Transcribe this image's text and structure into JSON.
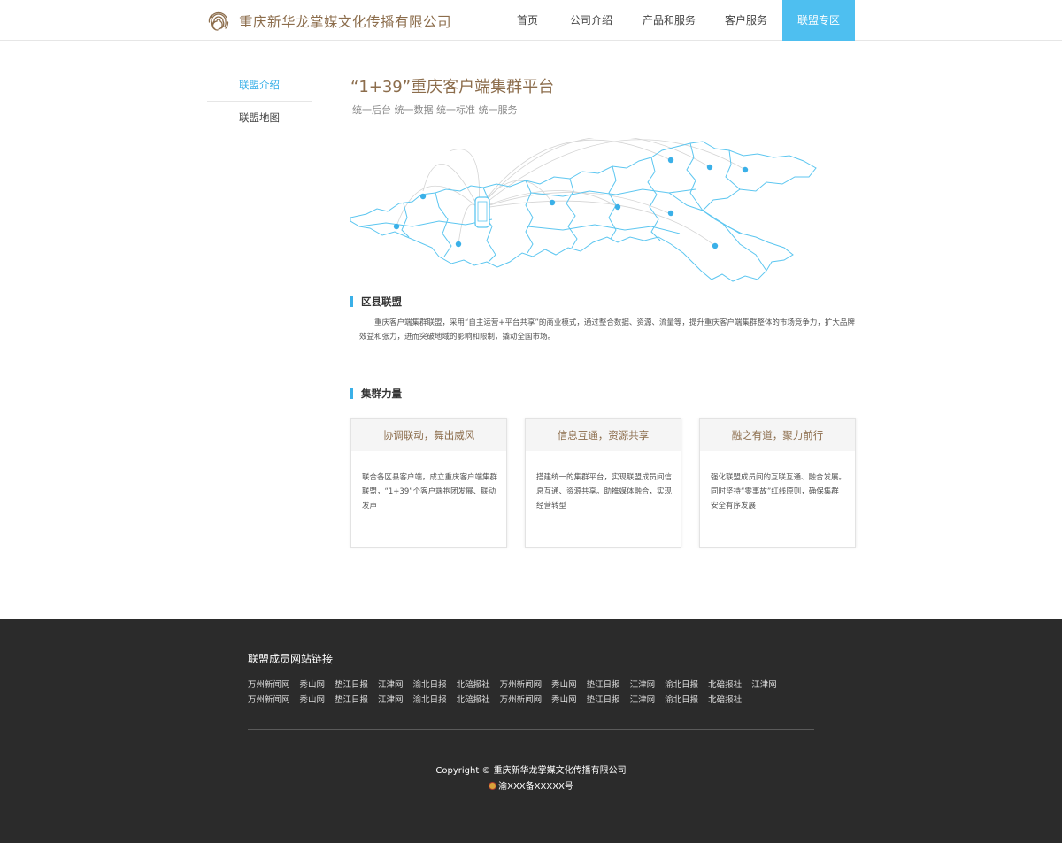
{
  "header": {
    "company_name": "重庆新华龙掌媒文化传播有限公司",
    "nav": [
      {
        "label": "首页"
      },
      {
        "label": "公司介绍"
      },
      {
        "label": "产品和服务"
      },
      {
        "label": "客户服务"
      },
      {
        "label": "联盟专区"
      }
    ],
    "active_nav": "联盟专区"
  },
  "sidebar": {
    "items": [
      {
        "label": "联盟介绍"
      },
      {
        "label": "联盟地图"
      }
    ],
    "active_item": "联盟介绍"
  },
  "main": {
    "title": "“1+39”重庆客户端集群平台",
    "subtitle": "统一后台 统一数据 统一标准 统一服务",
    "map_icon": "chongqing-map-illustration",
    "section1": {
      "title": "区县联盟",
      "text": "重庆客户端集群联盟，采用“自主运营+平台共享”的商业模式，通过整合数据、资源、流量等，提升重庆客户端集群整体的市场竞争力，扩大品牌效益和张力，进而突破地域的影响和限制，撬动全国市场。"
    },
    "section2": {
      "title": "集群力量",
      "cards": [
        {
          "title": "协调联动，舞出威风",
          "text": "联合各区县客户端，成立重庆客户端集群联盟，“1+39”个客户端抱团发展、联动发声"
        },
        {
          "title": "信息互通，资源共享",
          "text": "搭建统一的集群平台，实现联盟成员间信息互通、资源共享。助推媒体融合，实现经营转型"
        },
        {
          "title": "融之有道，聚力前行",
          "text": "强化联盟成员间的互联互通、融合发展。同时坚持“零事故”红线原则，确保集群安全有序发展"
        }
      ]
    }
  },
  "footer": {
    "links_title": "联盟成员网站链接",
    "links_row1": [
      "万州新闻网",
      "秀山网",
      "垫江日报",
      "江津网",
      "渝北日报",
      "北碚报社",
      "万州新闻网",
      "秀山网",
      "垫江日报",
      "江津网",
      "渝北日报",
      "北碚报社",
      "江津网"
    ],
    "links_row2": [
      "万州新闻网",
      "秀山网",
      "垫江日报",
      "江津网",
      "渝北日报",
      "北碚报社",
      "万州新闻网",
      "秀山网",
      "垫江日报",
      "江津网",
      "渝北日报",
      "北碚报社"
    ],
    "copyright": "Copyright © 重庆新华龙掌媒文化传播有限公司",
    "icp": "渝XXX备XXXXX号"
  },
  "colors": {
    "accent": "#4ebff0",
    "brand_brown": "#8c6d4c",
    "footer_bg": "#2b2b2b"
  }
}
